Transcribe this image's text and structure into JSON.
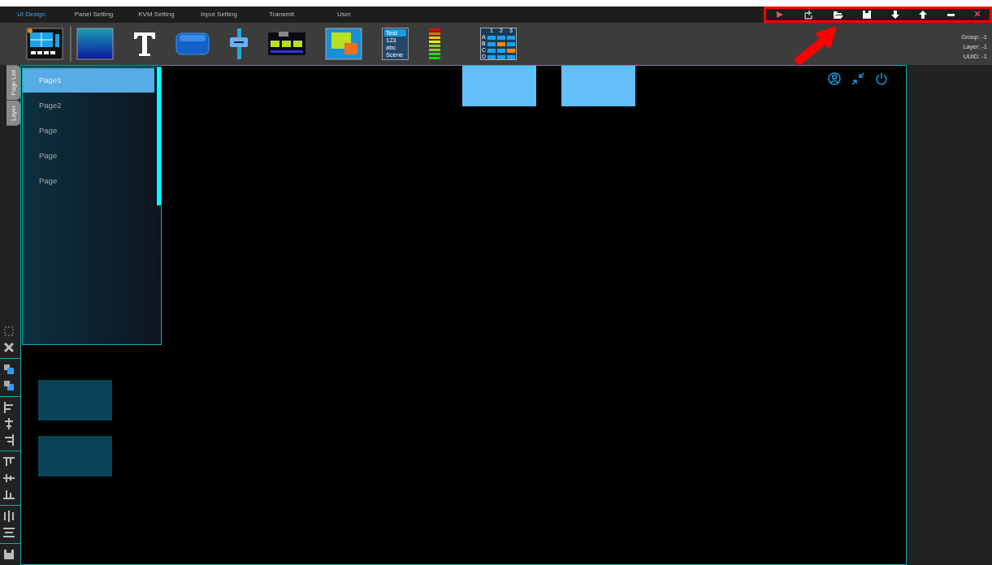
{
  "tabs": [
    {
      "label": "UI Design",
      "selected": true
    },
    {
      "label": "Panel Setting",
      "selected": false
    },
    {
      "label": "KVM Setting",
      "selected": false
    },
    {
      "label": "Input Setting",
      "selected": false
    },
    {
      "label": "Transmit",
      "selected": false
    },
    {
      "label": "User",
      "selected": false
    }
  ],
  "list_widget": {
    "items": [
      {
        "label": "Test",
        "selected": true
      },
      {
        "label": "123",
        "selected": false
      },
      {
        "label": "abc",
        "selected": false
      },
      {
        "label": "Scene",
        "selected": false
      }
    ]
  },
  "matrix_widget": {
    "columns": [
      "1",
      "2",
      "3"
    ],
    "rows": [
      "A",
      "B",
      "C",
      "D"
    ]
  },
  "info": [
    "Group: -1",
    "Layer: -1",
    "UUID: -1"
  ],
  "side_tabs": [
    "Page List",
    "Layer"
  ],
  "pages": [
    {
      "label": "Page1",
      "selected": true
    },
    {
      "label": "Page2",
      "selected": false
    },
    {
      "label": "Page",
      "selected": false
    },
    {
      "label": "Page",
      "selected": false
    },
    {
      "label": "Page",
      "selected": false
    }
  ]
}
